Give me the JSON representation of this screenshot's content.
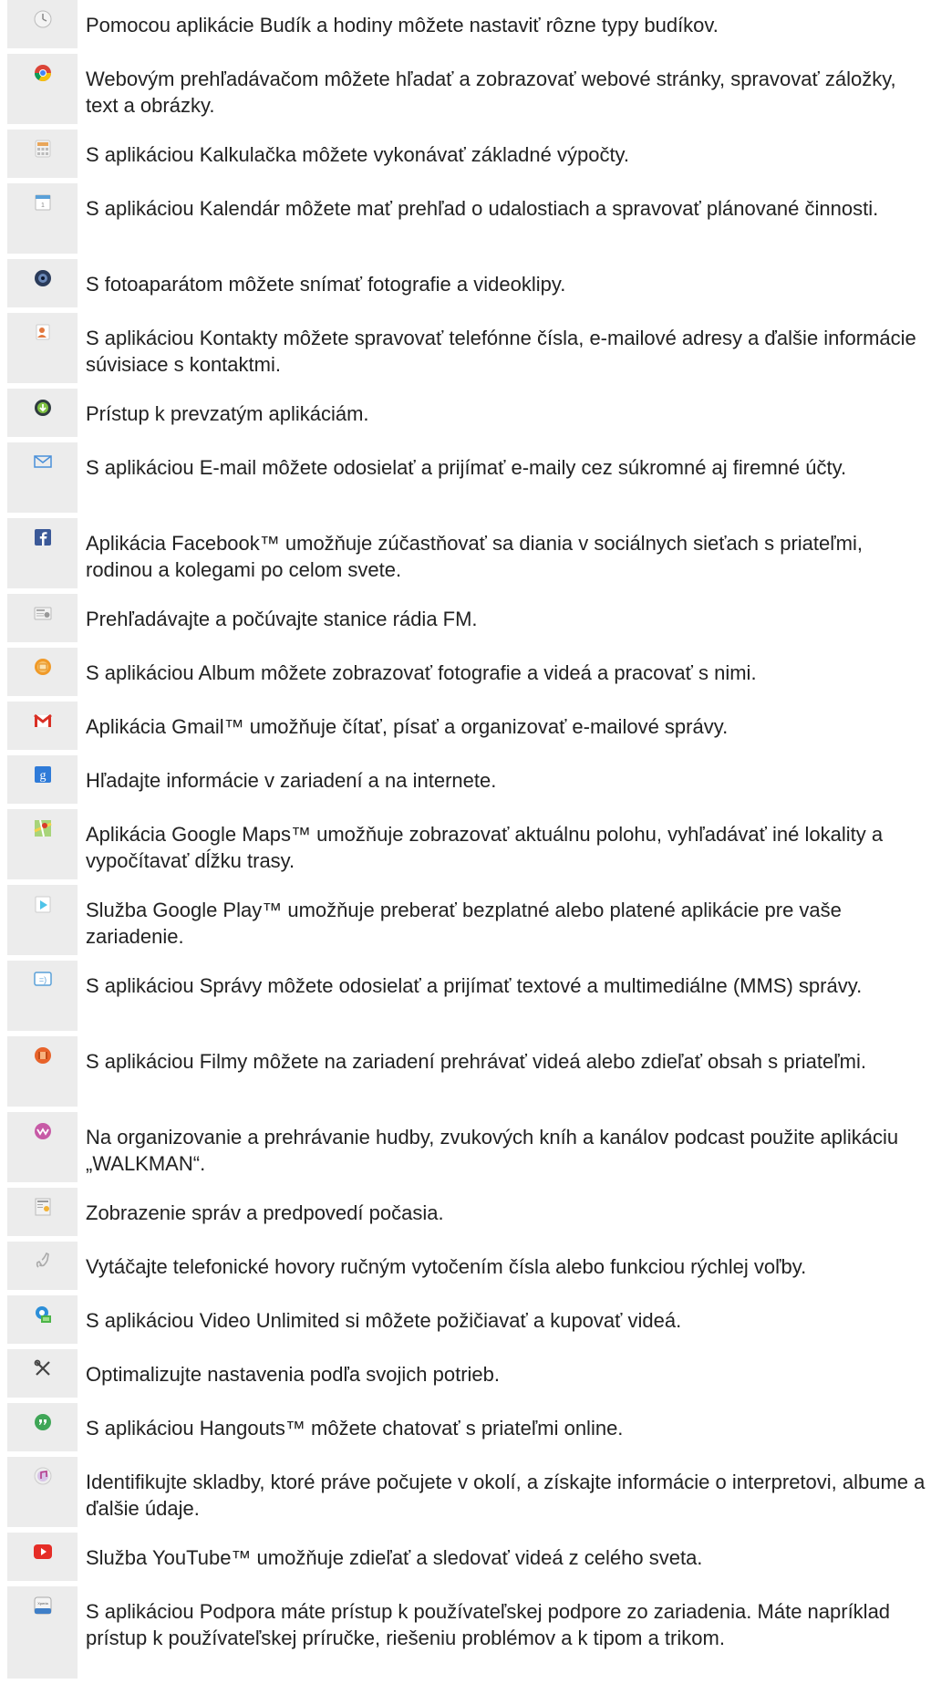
{
  "apps": [
    {
      "icon": "clock-icon",
      "text": "Pomocou aplikácie Budík a hodiny môžete nastaviť rôzne typy budíkov.",
      "lines": 1
    },
    {
      "icon": "chrome-browser-icon",
      "text": "Webovým prehľadávačom môžete hľadať a zobrazovať webové stránky, spravovať záložky, text a obrázky.",
      "lines": 2
    },
    {
      "icon": "calculator-icon",
      "text": "S aplikáciou Kalkulačka môžete vykonávať základné výpočty.",
      "lines": 1
    },
    {
      "icon": "calendar-icon",
      "text": "S aplikáciou Kalendár môžete mať prehľad o udalostiach a spravovať plánované činnosti.",
      "lines": 2
    },
    {
      "icon": "camera-icon",
      "text": "S fotoaparátom môžete snímať fotografie a videoklipy.",
      "lines": 1
    },
    {
      "icon": "contacts-icon",
      "text": "S aplikáciou Kontakty môžete spravovať telefónne čísla, e-mailové adresy a ďalšie informácie súvisiace s kontaktmi.",
      "lines": 2
    },
    {
      "icon": "download-icon",
      "text": "Prístup k prevzatým aplikáciám.",
      "lines": 1
    },
    {
      "icon": "email-icon",
      "text": "S aplikáciou E-mail môžete odosielať a prijímať e-maily cez súkromné aj firemné účty.",
      "lines": 2
    },
    {
      "icon": "facebook-icon",
      "text": "Aplikácia Facebook™ umožňuje zúčastňovať sa diania v sociálnych sieťach s priateľmi, rodinou a kolegami po celom svete.",
      "lines": 2
    },
    {
      "icon": "fm-radio-icon",
      "text": "Prehľadávajte a počúvajte stanice rádia FM.",
      "lines": 1
    },
    {
      "icon": "album-icon",
      "text": "S aplikáciou Album môžete zobrazovať fotografie a videá a pracovať s nimi.",
      "lines": 1
    },
    {
      "icon": "gmail-icon",
      "text": "Aplikácia Gmail™ umožňuje čítať, písať a organizovať e-mailové správy.",
      "lines": 1
    },
    {
      "icon": "google-search-icon",
      "text": "Hľadajte informácie v zariadení a na internete.",
      "lines": 1
    },
    {
      "icon": "google-maps-icon",
      "text": "Aplikácia Google Maps™ umožňuje zobrazovať aktuálnu polohu, vyhľadávať iné lokality a vypočítavať dĺžku trasy.",
      "lines": 2
    },
    {
      "icon": "google-play-icon",
      "text": "Služba Google Play™ umožňuje preberať bezplatné alebo platené aplikácie pre vaše zariadenie.",
      "lines": 2
    },
    {
      "icon": "messaging-icon",
      "text": "S aplikáciou Správy môžete odosielať a prijímať textové a multimediálne (MMS) správy.",
      "lines": 2
    },
    {
      "icon": "movies-icon",
      "text": "S aplikáciou Filmy môžete na zariadení prehrávať videá alebo zdieľať obsah s priateľmi.",
      "lines": 2
    },
    {
      "icon": "walkman-icon",
      "text": "Na organizovanie a prehrávanie hudby, zvukových kníh a kanálov podcast použite aplikáciu „WALKMAN“.",
      "lines": 2
    },
    {
      "icon": "news-weather-icon",
      "text": "Zobrazenie správ a predpovedí počasia.",
      "lines": 1
    },
    {
      "icon": "phone-icon",
      "text": "Vytáčajte telefonické hovory ručným vytočením čísla alebo funkciou rýchlej voľby.",
      "lines": 1
    },
    {
      "icon": "video-unlimited-icon",
      "text": "S aplikáciou Video Unlimited si môžete požičiavať a kupovať videá.",
      "lines": 1
    },
    {
      "icon": "settings-tools-icon",
      "text": "Optimalizujte nastavenia podľa svojich potrieb.",
      "lines": 1
    },
    {
      "icon": "hangouts-icon",
      "text": "S aplikáciou Hangouts™ môžete chatovať s priateľmi online.",
      "lines": 1
    },
    {
      "icon": "trackid-icon",
      "text": "Identifikujte skladby, ktoré práve počujete v okolí, a získajte informácie o interpretovi, albume a ďalšie údaje.",
      "lines": 2
    },
    {
      "icon": "youtube-icon",
      "text": "Služba YouTube™ umožňuje zdieľať a sledovať videá z celého sveta.",
      "lines": 1
    },
    {
      "icon": "xperia-care-icon",
      "text": "S aplikáciou Podpora máte prístup k používateľskej podpore zo zariadenia. Máte napríklad prístup k používateľskej príručke, riešeniu problémov a k tipom a trikom.",
      "lines": 3
    }
  ]
}
